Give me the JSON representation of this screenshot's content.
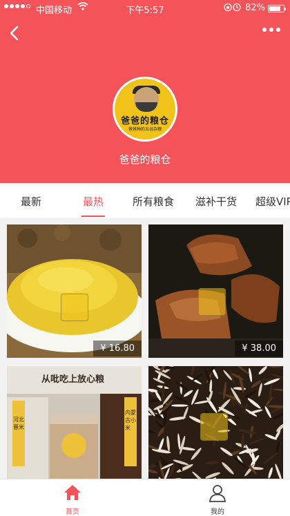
{
  "status_bar": {
    "carrier": "中国移动",
    "time": "下午5:57",
    "battery_percent": "82%",
    "battery_level": 0.82,
    "signal_bars_filled": 4
  },
  "header": {
    "shop_name": "爸爸的粮仓",
    "logo_text": "爸爸的粮仓",
    "logo_subtext": "爸爸种的五谷杂粮",
    "back_icon": "back-chevron-icon",
    "more_icon": "more-dots-icon"
  },
  "tabs": [
    {
      "label": "最新",
      "active": false
    },
    {
      "label": "最热",
      "active": true
    },
    {
      "label": "所有粮食",
      "active": false
    },
    {
      "label": "滋补干货",
      "active": false
    },
    {
      "label": "超级VIP",
      "active": false
    }
  ],
  "products": [
    {
      "name": "millet",
      "price": "¥ 16.80"
    },
    {
      "name": "brown-sugar",
      "price": "¥ 38.00"
    },
    {
      "name": "grain-jars",
      "price": "",
      "banner": "从吡吃上放心粮",
      "jar_labels": [
        "河北薏米",
        "内蒙古小米"
      ]
    },
    {
      "name": "wild-rice",
      "price": ""
    }
  ],
  "bottom_nav": [
    {
      "label": "首页",
      "icon": "home-icon",
      "active": true
    },
    {
      "label": "我的",
      "icon": "profile-icon",
      "active": false
    }
  ],
  "colors": {
    "brand_red": "#f4535a",
    "logo_yellow": "#f0c21a"
  }
}
